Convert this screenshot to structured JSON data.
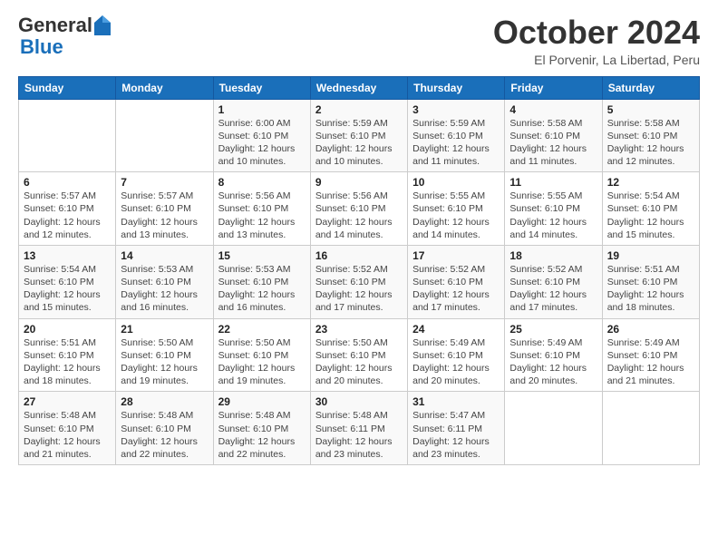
{
  "header": {
    "logo_line1": "General",
    "logo_line2": "Blue",
    "month": "October 2024",
    "location": "El Porvenir, La Libertad, Peru"
  },
  "days_of_week": [
    "Sunday",
    "Monday",
    "Tuesday",
    "Wednesday",
    "Thursday",
    "Friday",
    "Saturday"
  ],
  "weeks": [
    [
      {
        "day": "",
        "info": ""
      },
      {
        "day": "",
        "info": ""
      },
      {
        "day": "1",
        "info": "Sunrise: 6:00 AM\nSunset: 6:10 PM\nDaylight: 12 hours\nand 10 minutes."
      },
      {
        "day": "2",
        "info": "Sunrise: 5:59 AM\nSunset: 6:10 PM\nDaylight: 12 hours\nand 10 minutes."
      },
      {
        "day": "3",
        "info": "Sunrise: 5:59 AM\nSunset: 6:10 PM\nDaylight: 12 hours\nand 11 minutes."
      },
      {
        "day": "4",
        "info": "Sunrise: 5:58 AM\nSunset: 6:10 PM\nDaylight: 12 hours\nand 11 minutes."
      },
      {
        "day": "5",
        "info": "Sunrise: 5:58 AM\nSunset: 6:10 PM\nDaylight: 12 hours\nand 12 minutes."
      }
    ],
    [
      {
        "day": "6",
        "info": "Sunrise: 5:57 AM\nSunset: 6:10 PM\nDaylight: 12 hours\nand 12 minutes."
      },
      {
        "day": "7",
        "info": "Sunrise: 5:57 AM\nSunset: 6:10 PM\nDaylight: 12 hours\nand 13 minutes."
      },
      {
        "day": "8",
        "info": "Sunrise: 5:56 AM\nSunset: 6:10 PM\nDaylight: 12 hours\nand 13 minutes."
      },
      {
        "day": "9",
        "info": "Sunrise: 5:56 AM\nSunset: 6:10 PM\nDaylight: 12 hours\nand 14 minutes."
      },
      {
        "day": "10",
        "info": "Sunrise: 5:55 AM\nSunset: 6:10 PM\nDaylight: 12 hours\nand 14 minutes."
      },
      {
        "day": "11",
        "info": "Sunrise: 5:55 AM\nSunset: 6:10 PM\nDaylight: 12 hours\nand 14 minutes."
      },
      {
        "day": "12",
        "info": "Sunrise: 5:54 AM\nSunset: 6:10 PM\nDaylight: 12 hours\nand 15 minutes."
      }
    ],
    [
      {
        "day": "13",
        "info": "Sunrise: 5:54 AM\nSunset: 6:10 PM\nDaylight: 12 hours\nand 15 minutes."
      },
      {
        "day": "14",
        "info": "Sunrise: 5:53 AM\nSunset: 6:10 PM\nDaylight: 12 hours\nand 16 minutes."
      },
      {
        "day": "15",
        "info": "Sunrise: 5:53 AM\nSunset: 6:10 PM\nDaylight: 12 hours\nand 16 minutes."
      },
      {
        "day": "16",
        "info": "Sunrise: 5:52 AM\nSunset: 6:10 PM\nDaylight: 12 hours\nand 17 minutes."
      },
      {
        "day": "17",
        "info": "Sunrise: 5:52 AM\nSunset: 6:10 PM\nDaylight: 12 hours\nand 17 minutes."
      },
      {
        "day": "18",
        "info": "Sunrise: 5:52 AM\nSunset: 6:10 PM\nDaylight: 12 hours\nand 17 minutes."
      },
      {
        "day": "19",
        "info": "Sunrise: 5:51 AM\nSunset: 6:10 PM\nDaylight: 12 hours\nand 18 minutes."
      }
    ],
    [
      {
        "day": "20",
        "info": "Sunrise: 5:51 AM\nSunset: 6:10 PM\nDaylight: 12 hours\nand 18 minutes."
      },
      {
        "day": "21",
        "info": "Sunrise: 5:50 AM\nSunset: 6:10 PM\nDaylight: 12 hours\nand 19 minutes."
      },
      {
        "day": "22",
        "info": "Sunrise: 5:50 AM\nSunset: 6:10 PM\nDaylight: 12 hours\nand 19 minutes."
      },
      {
        "day": "23",
        "info": "Sunrise: 5:50 AM\nSunset: 6:10 PM\nDaylight: 12 hours\nand 20 minutes."
      },
      {
        "day": "24",
        "info": "Sunrise: 5:49 AM\nSunset: 6:10 PM\nDaylight: 12 hours\nand 20 minutes."
      },
      {
        "day": "25",
        "info": "Sunrise: 5:49 AM\nSunset: 6:10 PM\nDaylight: 12 hours\nand 20 minutes."
      },
      {
        "day": "26",
        "info": "Sunrise: 5:49 AM\nSunset: 6:10 PM\nDaylight: 12 hours\nand 21 minutes."
      }
    ],
    [
      {
        "day": "27",
        "info": "Sunrise: 5:48 AM\nSunset: 6:10 PM\nDaylight: 12 hours\nand 21 minutes."
      },
      {
        "day": "28",
        "info": "Sunrise: 5:48 AM\nSunset: 6:10 PM\nDaylight: 12 hours\nand 22 minutes."
      },
      {
        "day": "29",
        "info": "Sunrise: 5:48 AM\nSunset: 6:10 PM\nDaylight: 12 hours\nand 22 minutes."
      },
      {
        "day": "30",
        "info": "Sunrise: 5:48 AM\nSunset: 6:11 PM\nDaylight: 12 hours\nand 23 minutes."
      },
      {
        "day": "31",
        "info": "Sunrise: 5:47 AM\nSunset: 6:11 PM\nDaylight: 12 hours\nand 23 minutes."
      },
      {
        "day": "",
        "info": ""
      },
      {
        "day": "",
        "info": ""
      }
    ]
  ]
}
